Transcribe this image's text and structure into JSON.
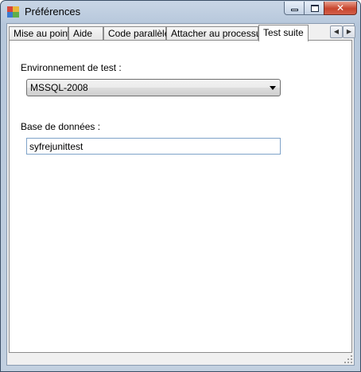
{
  "window": {
    "title": "Préférences",
    "icons": {
      "app": "app-icon",
      "minimize": "minimize-icon",
      "maximize": "maximize-icon",
      "close": "close-icon"
    }
  },
  "tabs": [
    {
      "label": "Mise au point",
      "active": false
    },
    {
      "label": "Aide",
      "active": false
    },
    {
      "label": "Code parallèle",
      "active": false
    },
    {
      "label": "Attacher au processus",
      "active": false
    },
    {
      "label": "Test suite",
      "active": true
    }
  ],
  "tab_scroll": {
    "left_icon": "chevron-left-icon",
    "right_icon": "chevron-right-icon"
  },
  "test_suite": {
    "environment_label": "Environnement de test :",
    "environment_value": "MSSQL-2008",
    "database_label": "Base de données :",
    "database_value": "syfrejunittest"
  }
}
